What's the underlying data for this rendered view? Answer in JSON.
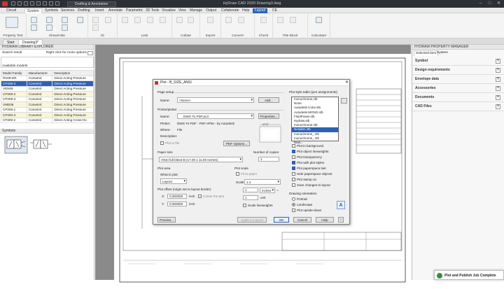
{
  "titlebar": {
    "workspace": "Drafting & Annotation",
    "title": "HyDraw CAD 2020    Drawing3.dwg"
  },
  "menu": [
    "Circuit",
    "System",
    "Symbols",
    "Services",
    "Drafting",
    "Insert",
    "Annotate",
    "Parametric",
    "3D Tools",
    "Visualize",
    "View",
    "Manage",
    "Output",
    "Collaborate",
    "Help",
    "Layout",
    "CE"
  ],
  "ribbon": {
    "groups": [
      "Property Test",
      "Show/Hide",
      "ID",
      "Lists",
      "Collate",
      "Export",
      "Convert",
      "Check",
      "Title Block",
      "Calculator"
    ]
  },
  "doctabs": [
    "Start",
    "Drawing3*"
  ],
  "left": {
    "header": "HYDRAW LIBRARY EXPLORER",
    "search_label": "Search result",
    "search_hint": "Right click for more options",
    "available": "Available models",
    "columns": [
      "Model Family",
      "Manufacturer",
      "Description"
    ],
    "rows": [
      [
        "RV08-DR",
        "Cometrol",
        "Direct Acting Pressure"
      ],
      [
        "CP208-3",
        "Cometrol",
        "Direct Acting Pressure"
      ],
      [
        "VEN08",
        "Cometrol",
        "Direct Acting Pressure"
      ],
      [
        "CP208-2",
        "Cometrol",
        "Direct Acting Pressure"
      ],
      [
        "CP208-3",
        "Cometrol",
        "Direct Acting Pressure"
      ],
      [
        "VMD06",
        "Cometrol",
        "Direct Acting Pressure"
      ],
      [
        "CP208-1",
        "Cometrol",
        "Direct Acting Pressure"
      ],
      [
        "CP200-3",
        "Cometrol",
        "Direct Acting Pressure"
      ],
      [
        "CP208-2",
        "Cometrol",
        "Direct Acting Cross-Ov"
      ]
    ],
    "symbols_label": "Symbols"
  },
  "right": {
    "header": "HYDRAW PROPERTY MANAGER",
    "tabs": [
      "Selected Item",
      "System"
    ],
    "sections": [
      "Symbol",
      "Design requirements",
      "Envelope data",
      "Accessories",
      "Documents",
      "CAD Files"
    ]
  },
  "dialog": {
    "title": "Plot - B_SIZE_ANSI",
    "page_setup": "Page setup",
    "name_label": "Name:",
    "name_value": "<None>",
    "add_btn": "Add...",
    "printer": "Printer/plotter",
    "printer_name": "DWG To PDF.pc3",
    "properties_btn": "Properties...",
    "plotter_label": "Plotter:",
    "plotter_value": "DWG To PDF - PDF ePlot - by Autodesk",
    "where_label": "Where:",
    "where_value": "File",
    "desc_label": "Description:",
    "plot_to_file": "Plot to file",
    "pdf_options_btn": "PDF Options...",
    "paper_dims": "17.0\"",
    "paper_size_label": "Paper size",
    "paper_size_value": "ANSI full bleed B (17.00 x 11.00 Inches)",
    "copies_label": "Number of copies",
    "copies_value": "1",
    "plot_area": "Plot area",
    "what_to_plot": "What to plot:",
    "what_value": "Layout",
    "plot_scale": "Plot scale",
    "fit_to_paper": "Fit to paper",
    "scale_label": "Scale:",
    "scale_value": "1:1",
    "plot_offset": "Plot offset (origin set to layout border)",
    "x_label": "X:",
    "x_value": "0.000000",
    "y_label": "Y:",
    "y_value": "0.000000",
    "unit_inch": "inch",
    "center_plot": "Center the plot",
    "scale_num": "1",
    "scale_unit": "inches",
    "scale_den": "1",
    "scale_unit2": "unit",
    "scale_lineweights": "Scale lineweights",
    "preview_btn": "Preview...",
    "apply_btn": "Apply to Layout",
    "ok_btn": "OK",
    "cancel_btn": "Cancel",
    "help_btn": "Help",
    "style_table_label": "Plot style table (pen assignments)",
    "style_value": "monochrome.ctb",
    "style_list": [
      "monochrome.ctb",
      "None",
      "Autodesk-Color.stb",
      "Autodesk-MONO.stb",
      "FluidPower.stb",
      "Hydraw.stb",
      "monochrome.stb",
      "Nosiden.stb",
      "monochrome_.stb",
      "monochrome_.stb",
      "New..."
    ],
    "style_list_selected": 7,
    "options": [
      {
        "label": "Plot in background",
        "on": false
      },
      {
        "label": "Plot object lineweights",
        "on": true
      },
      {
        "label": "Plot transparency",
        "on": false
      },
      {
        "label": "Plot with plot styles",
        "on": true
      },
      {
        "label": "Plot paperspace last",
        "on": true
      },
      {
        "label": "Hide paperspace objects",
        "on": false
      },
      {
        "label": "Plot stamp on",
        "on": false
      },
      {
        "label": "Save changes to layout",
        "on": false
      }
    ],
    "orientation_label": "Drawing orientation",
    "portrait": "Portrait",
    "landscape": "Landscape",
    "upside_down": "Plot upside-down"
  },
  "toast": "Plot and Publish Job Complete"
}
